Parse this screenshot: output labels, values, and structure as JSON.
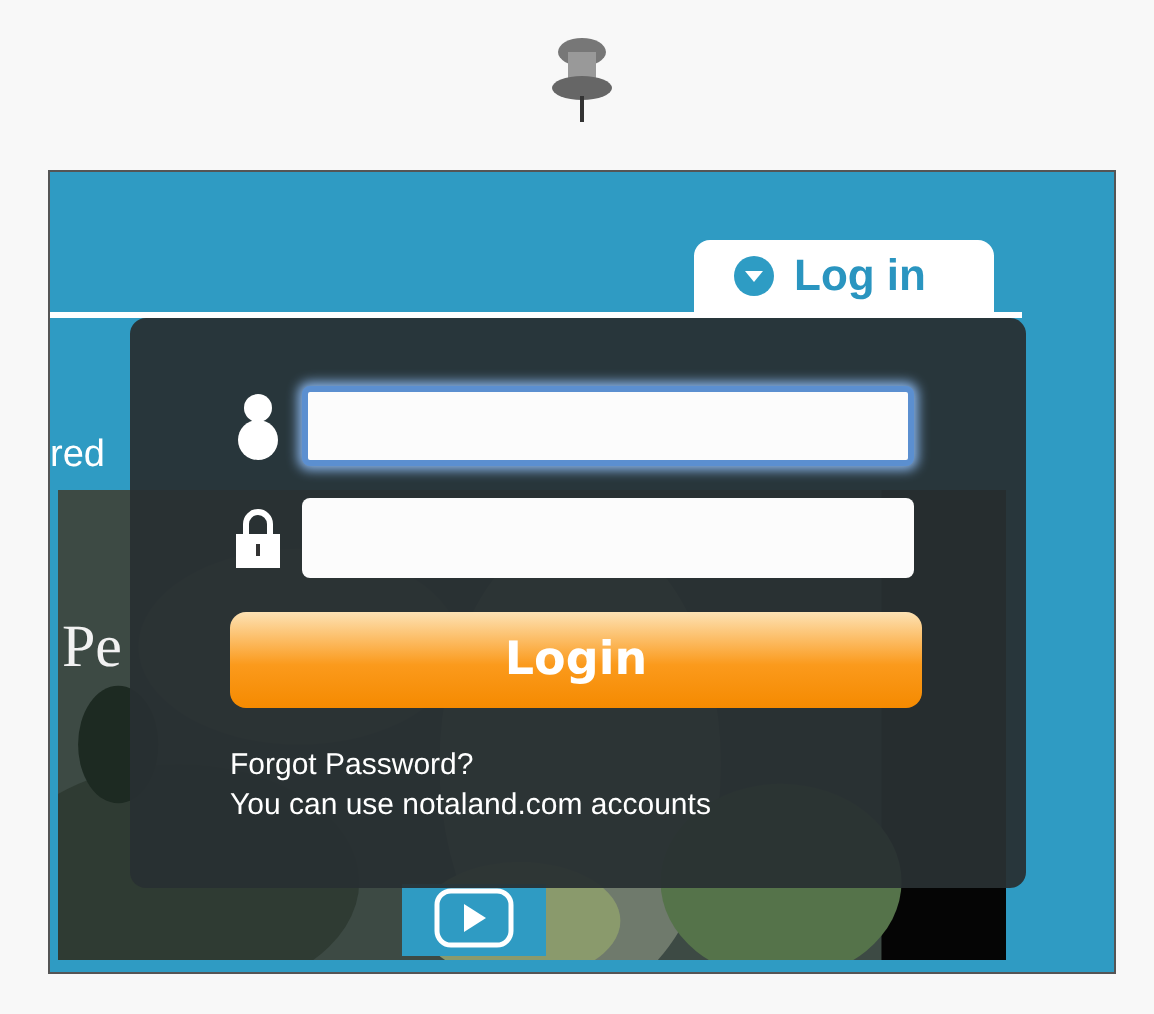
{
  "login_tab": {
    "label": "Log in",
    "selected": true
  },
  "banner": {
    "text": "red"
  },
  "video": {
    "title": "Pe"
  },
  "login_form": {
    "fields": [
      {
        "kind": "user",
        "focused": true
      },
      {
        "kind": "password",
        "focused": false
      }
    ],
    "button": "Login",
    "links": [
      "Forgot Password?"
    ],
    "note": "You can use notaland.com accounts"
  }
}
